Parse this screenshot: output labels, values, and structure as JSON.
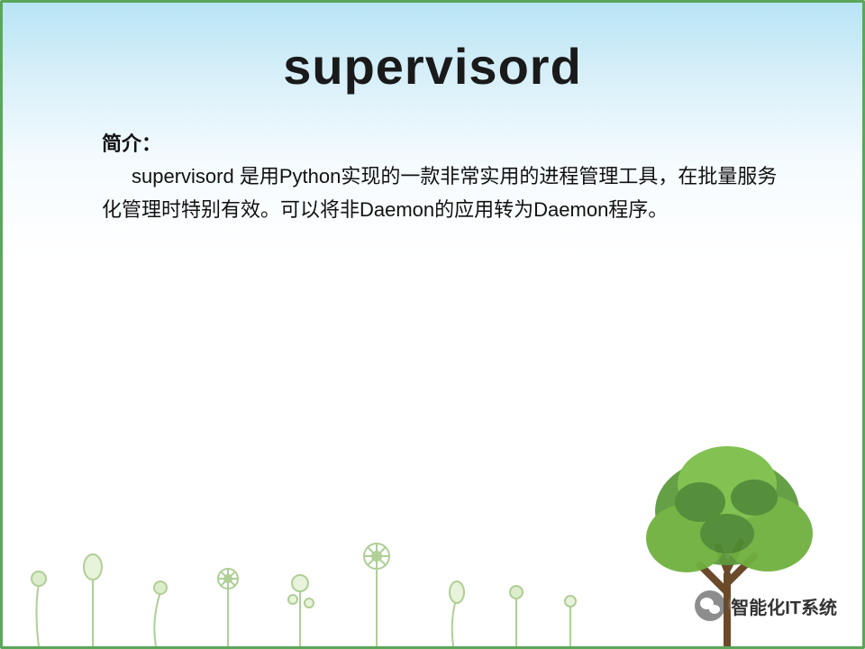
{
  "title": "supervisord",
  "intro": {
    "label": "简介：",
    "text": "supervisord 是用Python实现的一款非常实用的进程管理工具，在批量服务化管理时特别有效。可以将非Daemon的应用转为Daemon程序。"
  },
  "watermark": {
    "text": "智能化IT系统",
    "icon": "wechat-icon"
  },
  "colors": {
    "border": "#5aa65a",
    "accent_green": "#6fb03f",
    "accent_dark_green": "#3d7a2a"
  }
}
